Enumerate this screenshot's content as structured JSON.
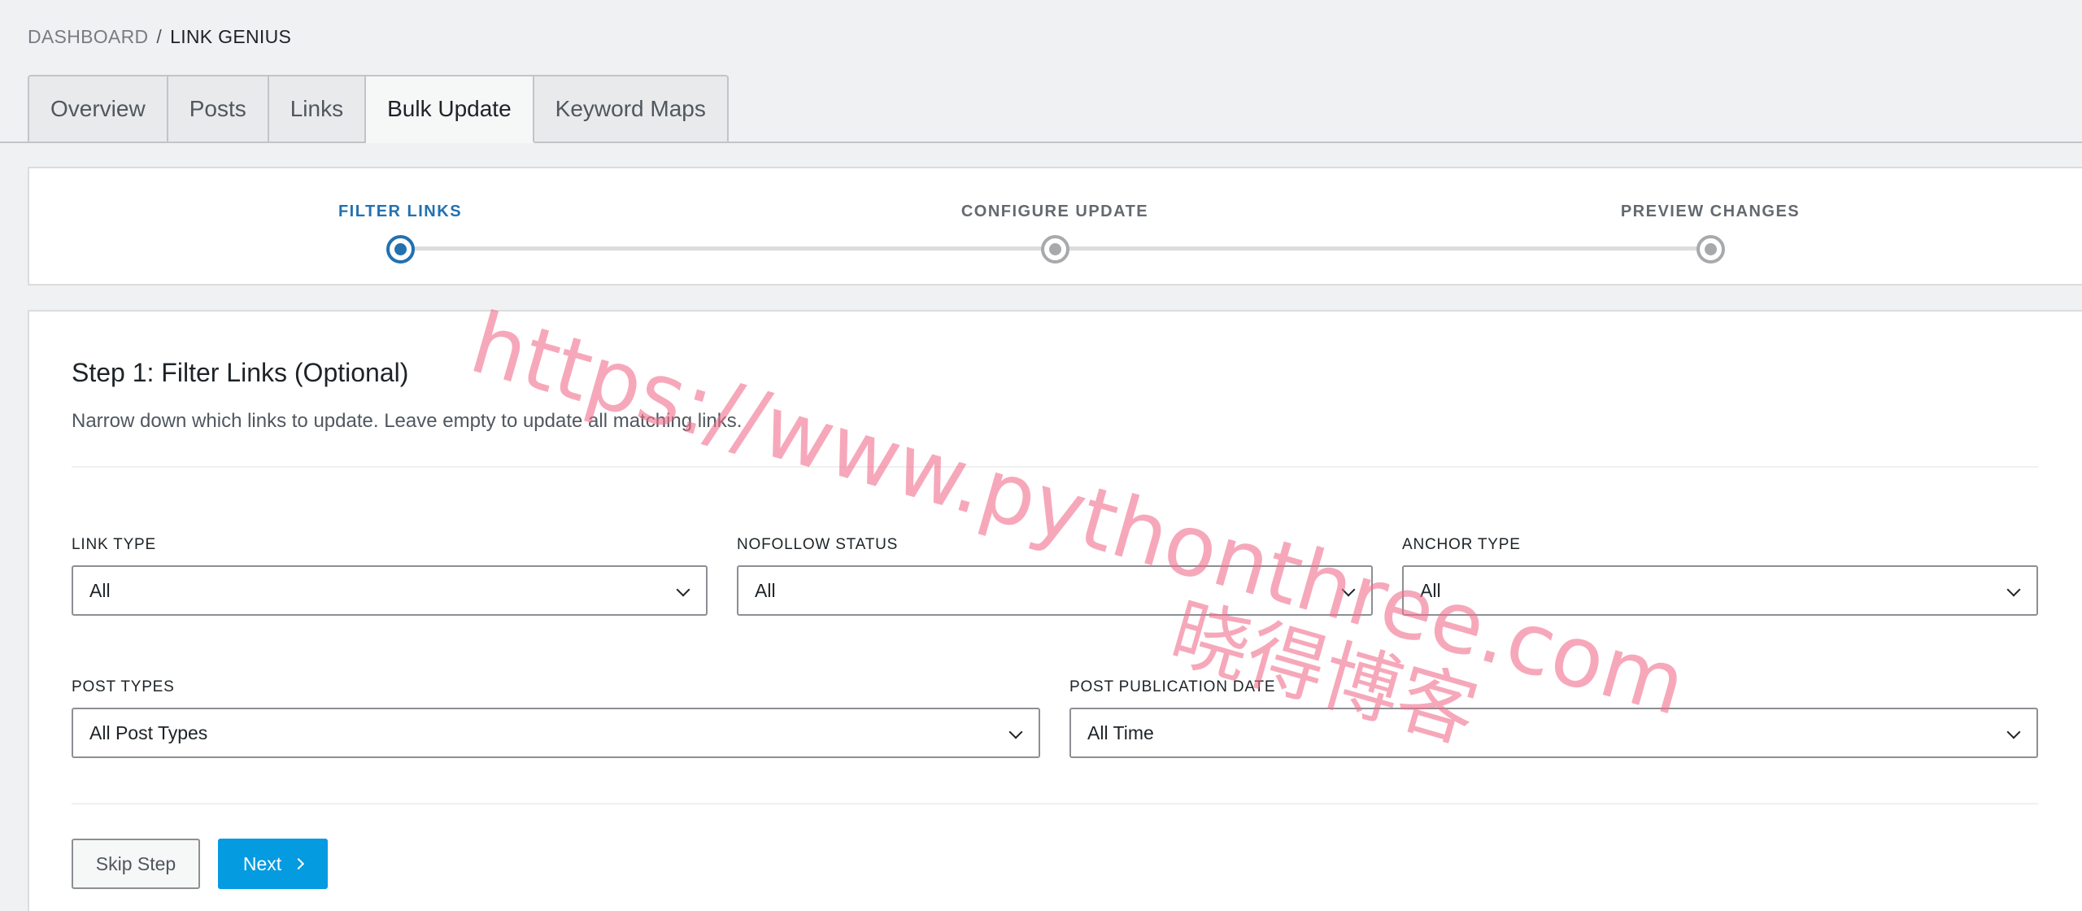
{
  "breadcrumb": {
    "parent": "DASHBOARD",
    "separator": "/",
    "current": "LINK GENIUS"
  },
  "tabs": [
    {
      "label": "Overview"
    },
    {
      "label": "Posts"
    },
    {
      "label": "Links"
    },
    {
      "label": "Bulk Update",
      "active": true
    },
    {
      "label": "Keyword Maps"
    }
  ],
  "stepper": {
    "steps": [
      {
        "label": "FILTER LINKS",
        "state": "active"
      },
      {
        "label": "CONFIGURE UPDATE",
        "state": "pending"
      },
      {
        "label": "PREVIEW CHANGES",
        "state": "pending"
      }
    ]
  },
  "form": {
    "title": "Step 1: Filter Links (Optional)",
    "description": "Narrow down which links to update. Leave empty to update all matching links.",
    "fields": {
      "link_type": {
        "label": "LINK TYPE",
        "value": "All"
      },
      "nofollow_status": {
        "label": "NOFOLLOW STATUS",
        "value": "All"
      },
      "anchor_type": {
        "label": "ANCHOR TYPE",
        "value": "All"
      },
      "post_types": {
        "label": "POST TYPES",
        "value": "All Post Types"
      },
      "post_publication_date": {
        "label": "POST PUBLICATION DATE",
        "value": "All Time"
      }
    },
    "buttons": {
      "skip": "Skip Step",
      "next": "Next"
    }
  },
  "watermark": {
    "url": "https://www.pythonthree.com",
    "cn": "晓得博客"
  },
  "colors": {
    "accent": "#2271b1",
    "primary_button": "#049be0",
    "watermark": "#f06e8c"
  }
}
